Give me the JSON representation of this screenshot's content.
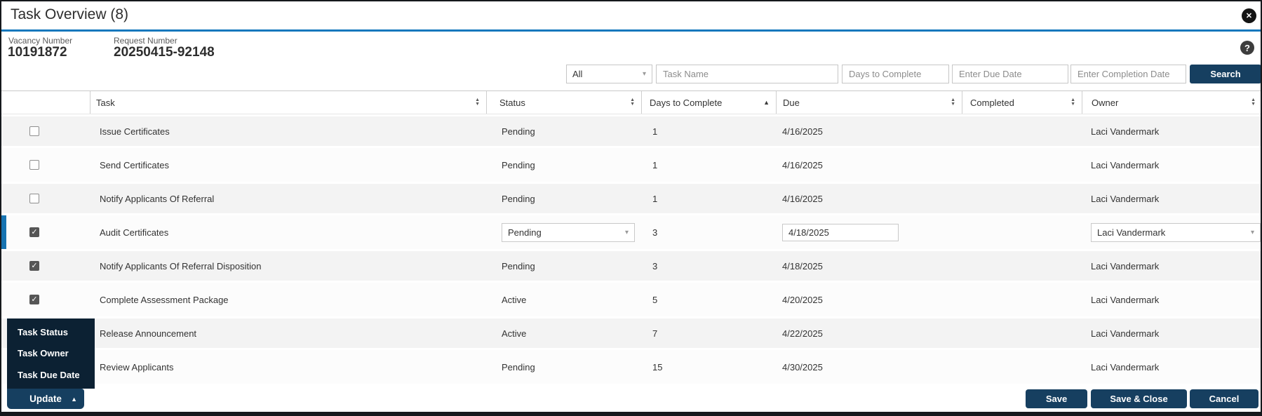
{
  "window": {
    "title": "Task Overview (8)"
  },
  "icons": {
    "close": "✕",
    "help": "?",
    "caret_down": "▾",
    "caret_up": "▲",
    "sort_up": "▲",
    "sort_down": "▼"
  },
  "info": {
    "vacancy_label": "Vacancy Number",
    "vacancy_value": "10191872",
    "request_label": "Request Number",
    "request_value": "20250415-92148"
  },
  "filters": {
    "type_value": "All",
    "task_name_placeholder": "Task Name",
    "days_placeholder": "Days to Complete",
    "due_placeholder": "Enter Due Date",
    "completion_placeholder": "Enter Completion Date",
    "search_label": "Search"
  },
  "table": {
    "columns": [
      {
        "label": "Task",
        "sort": "both"
      },
      {
        "label": "Status",
        "sort": "both"
      },
      {
        "label": "Days to Complete",
        "sort": "asc"
      },
      {
        "label": "Due",
        "sort": "both"
      },
      {
        "label": "Completed",
        "sort": "both"
      },
      {
        "label": "Owner",
        "sort": "both"
      }
    ],
    "rows": [
      {
        "task": "Issue Certificates",
        "status": "Pending",
        "days": "1",
        "due": "4/16/2025",
        "completed": "",
        "owner": "Laci Vandermark",
        "checked": false,
        "selected": false,
        "editable": false
      },
      {
        "task": "Send Certificates",
        "status": "Pending",
        "days": "1",
        "due": "4/16/2025",
        "completed": "",
        "owner": "Laci Vandermark",
        "checked": false,
        "selected": false,
        "editable": false
      },
      {
        "task": "Notify Applicants Of Referral",
        "status": "Pending",
        "days": "1",
        "due": "4/16/2025",
        "completed": "",
        "owner": "Laci Vandermark",
        "checked": false,
        "selected": false,
        "editable": false
      },
      {
        "task": "Audit Certificates",
        "status": "Pending",
        "days": "3",
        "due": "4/18/2025",
        "completed": "",
        "owner": "Laci Vandermark",
        "checked": true,
        "selected": true,
        "editable": true
      },
      {
        "task": "Notify Applicants Of Referral Disposition",
        "status": "Pending",
        "days": "3",
        "due": "4/18/2025",
        "completed": "",
        "owner": "Laci Vandermark",
        "checked": true,
        "selected": false,
        "editable": false
      },
      {
        "task": "Complete Assessment Package",
        "status": "Active",
        "days": "5",
        "due": "4/20/2025",
        "completed": "",
        "owner": "Laci Vandermark",
        "checked": true,
        "selected": false,
        "editable": false
      },
      {
        "task": "Release Announcement",
        "status": "Active",
        "days": "7",
        "due": "4/22/2025",
        "completed": "",
        "owner": "Laci Vandermark",
        "checked": false,
        "selected": false,
        "editable": false
      },
      {
        "task": "Review Applicants",
        "status": "Pending",
        "days": "15",
        "due": "4/30/2025",
        "completed": "",
        "owner": "Laci Vandermark",
        "checked": false,
        "selected": false,
        "editable": false
      }
    ]
  },
  "update_menu": {
    "items": [
      {
        "label": "Task Status"
      },
      {
        "label": "Task Owner"
      },
      {
        "label": "Task Due Date"
      }
    ],
    "button_label": "Update"
  },
  "footer": {
    "save_label": "Save",
    "save_close_label": "Save & Close",
    "cancel_label": "Cancel"
  },
  "colors": {
    "accent-blue": "#1478bd",
    "navy": "#163f60",
    "menu-bg": "#0c2133",
    "selected-bar": "#1673b1",
    "row-stripe": "#f3f3f3"
  }
}
